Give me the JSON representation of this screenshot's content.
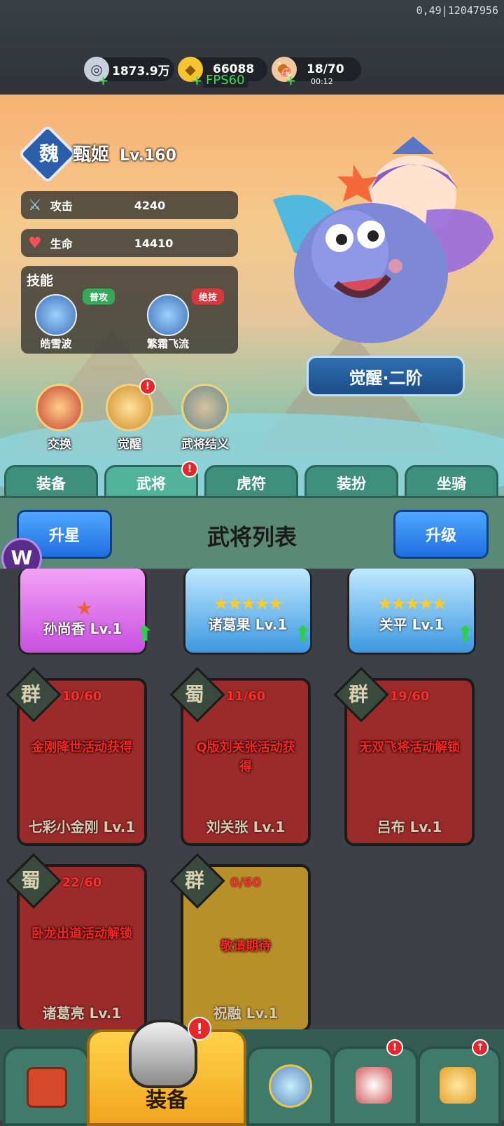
{
  "debug": "0,49|12047956",
  "resources": [
    {
      "icon": "silver-coin-icon",
      "value": "1873.9万"
    },
    {
      "icon": "gold-ingot-icon",
      "value": "66088",
      "sub": "FPS60"
    },
    {
      "icon": "meat-icon",
      "value": "18/70",
      "sub": "00:12"
    }
  ],
  "hero": {
    "faction": "魏",
    "name": "甄姬",
    "level": "Lv.160",
    "attack_label": "攻击",
    "attack_value": "4240",
    "hp_label": "生命",
    "hp_value": "14410",
    "skills_label": "技能",
    "skills": [
      {
        "name": "皓雪波",
        "tag": "普攻"
      },
      {
        "name": "繁霜飞流",
        "tag": "绝技"
      }
    ],
    "awaken_label": "觉醒·二阶"
  },
  "actions": [
    {
      "label": "交换",
      "badge": false
    },
    {
      "label": "觉醒",
      "badge": true
    },
    {
      "label": "武将结义",
      "badge": false
    }
  ],
  "badge_mark": "!",
  "tabs": [
    "装备",
    "武将",
    "虎符",
    "装扮",
    "坐骑"
  ],
  "list": {
    "title": "武将列表",
    "star_up": "升星",
    "level_up": "升级"
  },
  "owned": [
    {
      "name": "孙尚香 Lv.1",
      "stars": "★"
    },
    {
      "name": "诸葛果 Lv.1",
      "stars": "★★★★★"
    },
    {
      "name": "关平 Lv.1",
      "stars": "★★★★★"
    }
  ],
  "locked": [
    {
      "faction": "群",
      "progress": "10/60",
      "msg": "金刚降世活动获得",
      "name": "七彩小金刚 Lv.1"
    },
    {
      "faction": "蜀",
      "progress": "11/60",
      "msg": "Q版刘关张活动获得",
      "name": "刘关张 Lv.1"
    },
    {
      "faction": "群",
      "progress": "19/60",
      "msg": "无双飞将活动解锁",
      "name": "吕布 Lv.1"
    },
    {
      "faction": "蜀",
      "progress": "22/60",
      "msg": "卧龙出道活动解锁",
      "name": "诸葛亮 Lv.1"
    },
    {
      "faction": "群",
      "progress": "0/60",
      "msg": "敬请期待",
      "name": "祝融 Lv.1"
    }
  ],
  "nav": {
    "selected_label": "装备"
  }
}
